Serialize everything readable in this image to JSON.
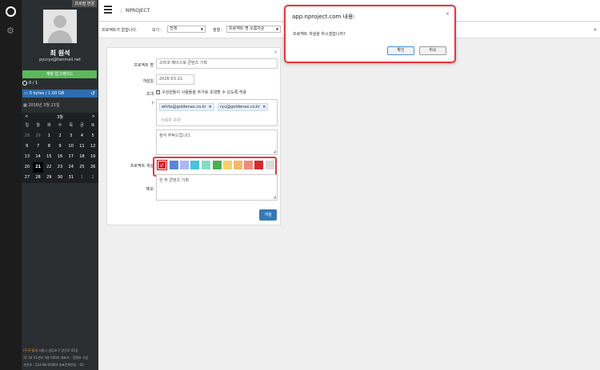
{
  "sidebar": {
    "profile_change": "프로필 변경",
    "name": "최 원석",
    "email": "pyuryz@hanmail.net",
    "upgrade": "계정 업그레이드",
    "project_count": "0 / 1",
    "storage": "0 bytes / 1.00 GB",
    "date": "2016년 3월 21일",
    "footer_brand": "(주)두올재",
    "footer_lines": [
      "(주)두올재 서울시 영등포구 양산로 41길",
      "11 54 V1센터 5층 000호 대표자 : 정철호 사업",
      "자번호 : 214-86-00484 대표전화번호 : 02-"
    ]
  },
  "calendar": {
    "month": "3월",
    "prev": "<",
    "next": ">",
    "dow": [
      "일",
      "월",
      "화",
      "수",
      "목",
      "금",
      "토"
    ],
    "weeks": [
      [
        "28",
        "29",
        "1",
        "2",
        "3",
        "4",
        "5"
      ],
      [
        "6",
        "7",
        "8",
        "9",
        "10",
        "11",
        "12"
      ],
      [
        "13",
        "14",
        "15",
        "16",
        "17",
        "18",
        "19"
      ],
      [
        "20",
        "21",
        "22",
        "23",
        "24",
        "25",
        "26"
      ],
      [
        "27",
        "28",
        "29",
        "30",
        "31",
        "1",
        "2"
      ]
    ]
  },
  "topbar": {
    "brand": "NPROJECT"
  },
  "filterbar": {
    "no_project": "프로젝트가 없습니다.",
    "view_label": "보기 :",
    "view_value": "전체",
    "sort_label": "정렬 :",
    "sort_value": "프로젝트 명 오름차순"
  },
  "form": {
    "name_label": "프로젝트 명",
    "name_value": "소마코 페이스북 콘텐츠 기획",
    "date_label": "개설일",
    "date_value": "2016-03-21",
    "invite_label": "초대",
    "invite_option": "구성원들이 사람들을 추가로 초대할 수 있도록 허용",
    "help": "?",
    "tags": [
      "white@goldenax.co.kr",
      "ryu@goldenax.co.kr"
    ],
    "invite_placeholder": "사용자 초대",
    "message_value": "참석 부탁드립니다.",
    "color_label": "프로젝트 색상",
    "colors": [
      "#d7282f",
      "#5b85d9",
      "#a9b8f0",
      "#44c4d9",
      "#84dcc4",
      "#4caf50",
      "#f5d16a",
      "#f5b86a",
      "#f08a7a",
      "#d7282f",
      "#d9d9d9"
    ],
    "memo_label": "메모",
    "memo_value": "한 주 콘텐츠 기획",
    "create_button": "개설"
  },
  "dialog": {
    "title": "app.nproject.com 내용:",
    "message": "프로젝트 개설을 하시겠습니까?",
    "ok": "확인",
    "cancel": "취소"
  }
}
